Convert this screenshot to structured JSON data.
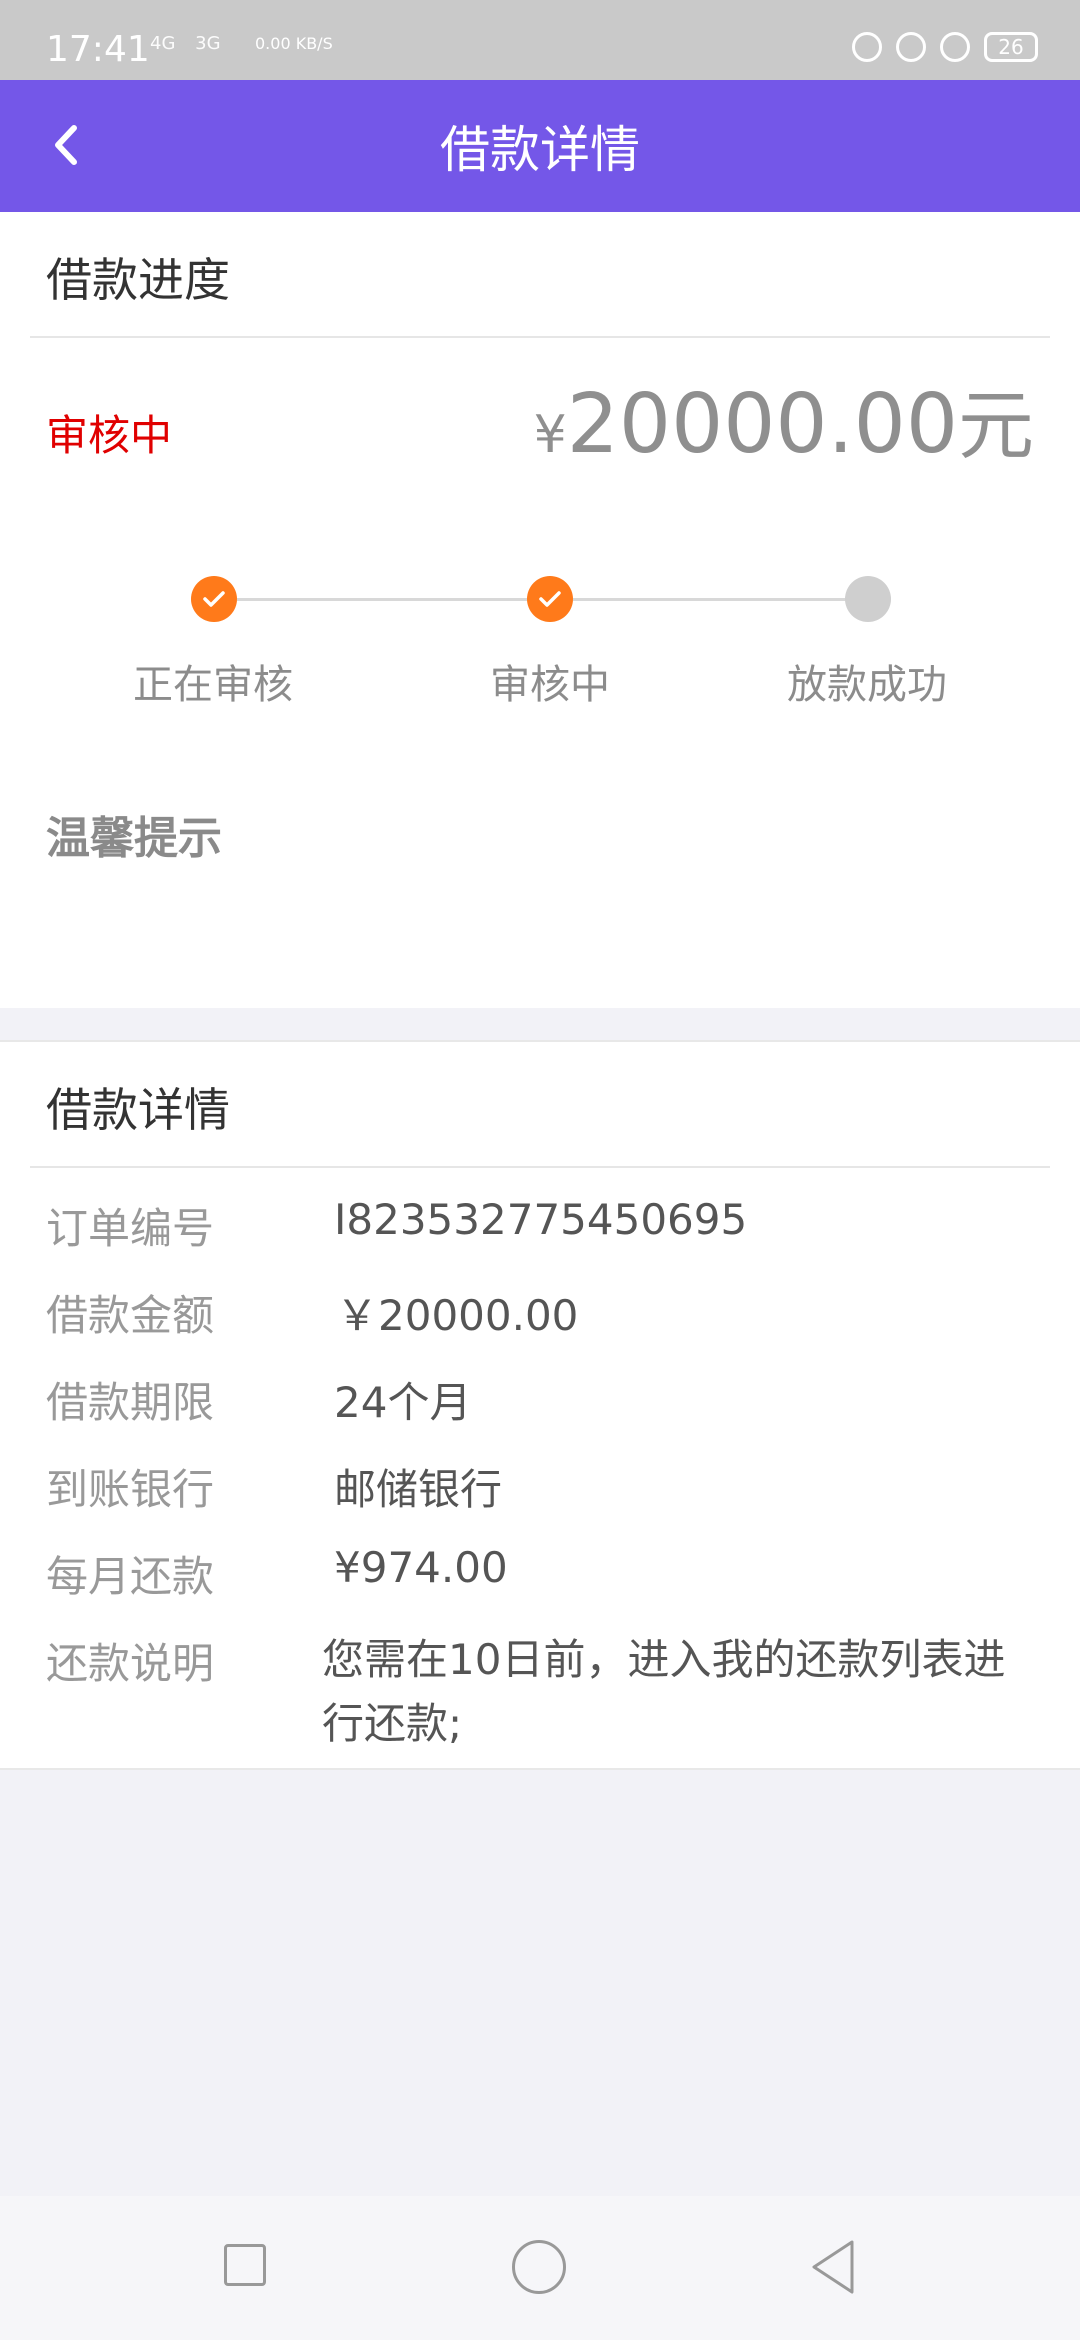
{
  "status_bar": {
    "time": "17:41",
    "net1": "4G",
    "net2": "3G",
    "speed": "0.00 KB/S",
    "battery": "26"
  },
  "header": {
    "title": "借款详情"
  },
  "progress": {
    "section_title": "借款进度",
    "status": "审核中",
    "amount_symbol": "¥",
    "amount_value": "20000.00",
    "amount_unit": "元",
    "steps": [
      "正在审核",
      "审核中",
      "放款成功"
    ],
    "tips_title": "温馨提示"
  },
  "details": {
    "section_title": "借款详情",
    "rows": [
      {
        "label": "订单编号",
        "value": "I823532775450695"
      },
      {
        "label": "借款金额",
        "value": "￥20000.00"
      },
      {
        "label": "借款期限",
        "value": "24个月"
      },
      {
        "label": "到账银行",
        "value": "邮储银行"
      },
      {
        "label": "每月还款",
        "value": "¥974.00"
      },
      {
        "label": "还款说明",
        "value": "您需在10日前，进入我的还款列表进行还款;"
      }
    ]
  },
  "colors": {
    "accent": "#7457e8",
    "status": "#e00000",
    "step_done": "#ff7a1a",
    "step_todo": "#cfcfcf"
  }
}
